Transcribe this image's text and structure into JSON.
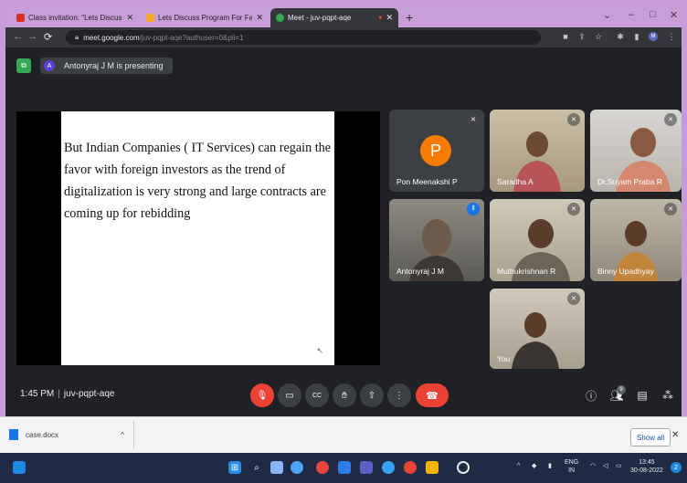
{
  "browser": {
    "tabs": [
      {
        "title": "Class invitation: \"Lets Discuss Pr",
        "active": false
      },
      {
        "title": "Lets Discuss Program For Faculti",
        "active": false
      },
      {
        "title": "Meet - juv-pqpt-aqe",
        "active": true
      }
    ],
    "url_host": "meet.google.com",
    "url_path": "/juv-pqpt-aqe?authuser=0&pli=1"
  },
  "meet": {
    "presenting_avatar_letter": "A",
    "presenting_text": "Antonyraj J M is presenting",
    "slide_text": "But Indian Companies ( IT Services) can regain the favor with foreign investors as the trend of digitalization is very strong and large contracts are coming up for rebidding",
    "participants": [
      {
        "name": "Pon Meenakshi P",
        "avatar_letter": "P"
      },
      {
        "name": "Saradha A"
      },
      {
        "name": "Dr.Suyam Praba R"
      },
      {
        "name": "Antonyraj J M"
      },
      {
        "name": "Muthukrishnan R"
      },
      {
        "name": "Binny Upadhyay"
      },
      {
        "name": "You"
      }
    ],
    "time": "1:45 PM",
    "meeting_code": "juv-pqpt-aqe",
    "participant_count": "9"
  },
  "downloads": {
    "file_name": "case.docx",
    "show_all": "Show all"
  },
  "taskbar": {
    "lang": "ENG",
    "region": "IN",
    "clock_time": "13:45",
    "clock_date": "30-08-2022"
  },
  "colors": {
    "end_call": "#ea4335",
    "accent": "#8ab4f8",
    "tab_bar": "#c89ed9"
  }
}
